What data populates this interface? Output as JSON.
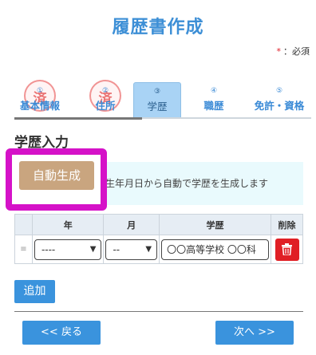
{
  "header": {
    "title": "履歴書作成"
  },
  "required_note": {
    "star": "*",
    "text": "：必須"
  },
  "steps": [
    {
      "num": "①",
      "label": "基本情報",
      "state": "done",
      "stamp": "済"
    },
    {
      "num": "②",
      "label": "住所",
      "state": "done",
      "stamp": "済"
    },
    {
      "num": "③",
      "label": "学歴",
      "state": "active"
    },
    {
      "num": "④",
      "label": "職歴",
      "state": "pending"
    },
    {
      "num": "⑤",
      "label": "免許・資格",
      "state": "pending"
    }
  ],
  "section": {
    "title": "学歴入力"
  },
  "auto_generate": {
    "button_label": "自動生成",
    "hint": "※生年月日から自動で学歴を生成します",
    "highlight_color": "#d512c8"
  },
  "table": {
    "headers": [
      "年",
      "月",
      "学歴",
      "削除"
    ],
    "rows": [
      {
        "handle": "≡",
        "year": "----",
        "month": "--",
        "school": "〇〇高等学校 〇〇科",
        "delete_icon": "trash-icon"
      }
    ]
  },
  "actions": {
    "add_label": "追加",
    "back_label": "<< 戻る",
    "next_label": "次へ >>"
  },
  "colors": {
    "accent": "#3a93dd",
    "danger": "#e01f25",
    "generate": "#c9a57f"
  }
}
